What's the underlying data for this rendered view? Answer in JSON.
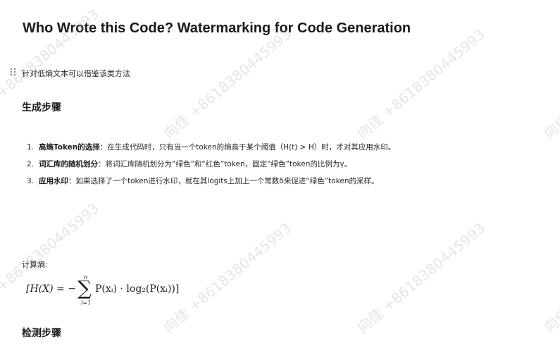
{
  "document": {
    "title": "Who Wrote this Code? Watermarking for Code Generation",
    "note": "针对低熵文本可以借鉴该类方法",
    "section_generation": "生成步骤",
    "steps": [
      {
        "num": "1.",
        "key": "高熵Token的选择",
        "text": "：在生成代码时，只有当一个token的熵高于某个阈值（H(t) > H）时，才对其应用水印。"
      },
      {
        "num": "2.",
        "key": "词汇库的随机划分",
        "text": "：将词汇库随机划分为“绿色”和“红色”token，固定“绿色”token的比例为γ。"
      },
      {
        "num": "3.",
        "key": "应用水印",
        "text": "：如果选择了一个token进行水印，就在其logits上加上一个常数δ来促进“绿色”token的采样。"
      }
    ],
    "entropy_label": "计算熵:",
    "formula": {
      "left": "[H(X) = −",
      "upper": "n",
      "lower": "i=1",
      "right": "P(xᵢ) · log₂(P(xᵢ))]"
    },
    "section_detection": "检测步骤"
  },
  "watermark": {
    "text_a": "向佳 +8618380445993",
    "text_b": "+8618380445993",
    "text_c": "向佳"
  }
}
